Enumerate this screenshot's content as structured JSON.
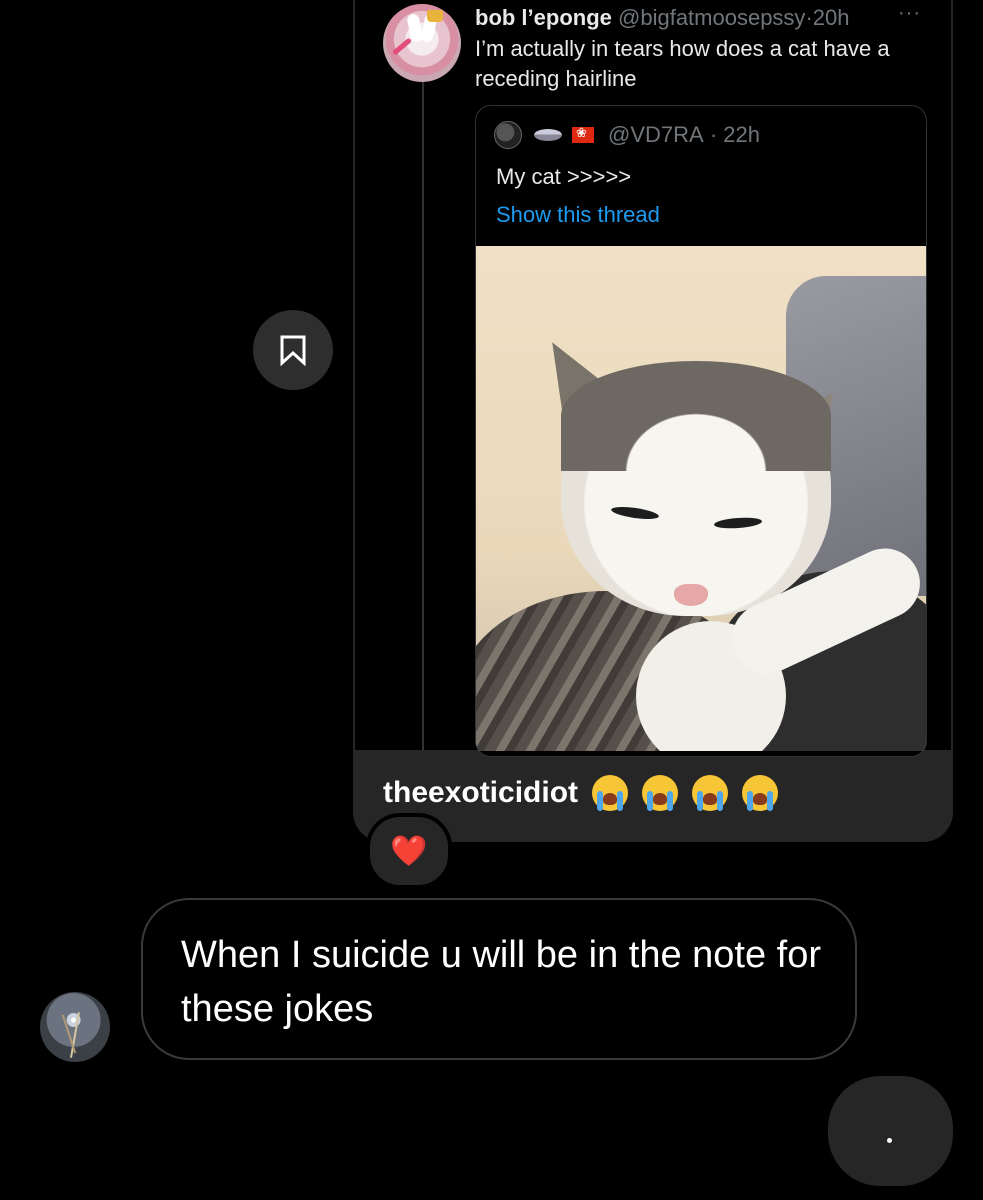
{
  "shared_post": {
    "tweet": {
      "display_name": "bob l’eponge",
      "handle": "@bigfatmoosepssy",
      "separator": "·",
      "time": "20h",
      "more_label": "···",
      "text": "I’m actually in tears how does a cat have a receding hairline"
    },
    "quote": {
      "handle": "@VD7RA",
      "separator": "·",
      "time": "22h",
      "text": "My cat >>>>>",
      "thread_link": "Show this thread",
      "emoji_names": [
        "ufo-emoji",
        "hong-kong-flag-emoji"
      ]
    },
    "caption": {
      "username": "theexoticidiot",
      "emoji_name": "loudly-crying-face-emoji",
      "emoji_count": 4
    }
  },
  "save_button": {
    "icon": "bookmark-icon"
  },
  "reaction": {
    "emoji": "❤️",
    "name": "red-heart-emoji"
  },
  "message": {
    "text": "When I suicide u will be in the note for these jokes"
  },
  "typing_indicator": {
    "text": "."
  }
}
